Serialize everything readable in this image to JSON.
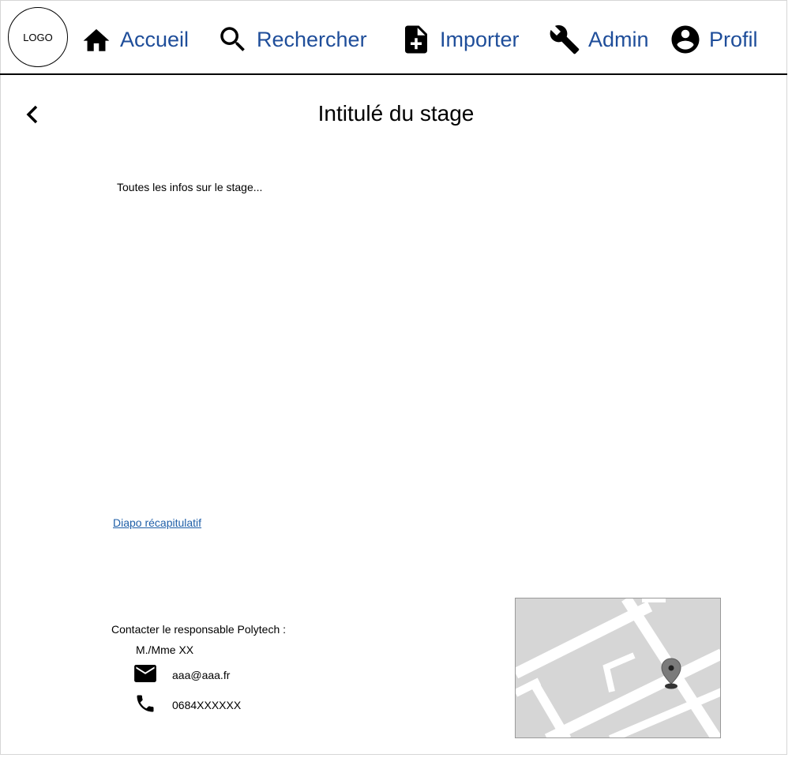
{
  "header": {
    "logo": "LOGO",
    "nav": [
      {
        "label": "Accueil",
        "icon": "home-icon"
      },
      {
        "label": "Rechercher",
        "icon": "search-icon"
      },
      {
        "label": "Importer",
        "icon": "file-plus-icon"
      },
      {
        "label": "Admin",
        "icon": "wrench-icon"
      },
      {
        "label": "Profil",
        "icon": "account-circle-icon"
      }
    ],
    "link_color": "#1f4e9a"
  },
  "page": {
    "title": "Intitulé du stage",
    "back_icon": "chevron-left-icon",
    "infos": "Toutes les infos sur le stage...",
    "diapo_link": "Diapo récapitulatif"
  },
  "contact": {
    "title": "Contacter le responsable Polytech :",
    "name": "M./Mme XX",
    "email": "aaa@aaa.fr",
    "email_icon": "mail-icon",
    "phone": "0684XXXXXX",
    "phone_icon": "phone-icon"
  },
  "map": {
    "icon": "map-pin-icon"
  }
}
